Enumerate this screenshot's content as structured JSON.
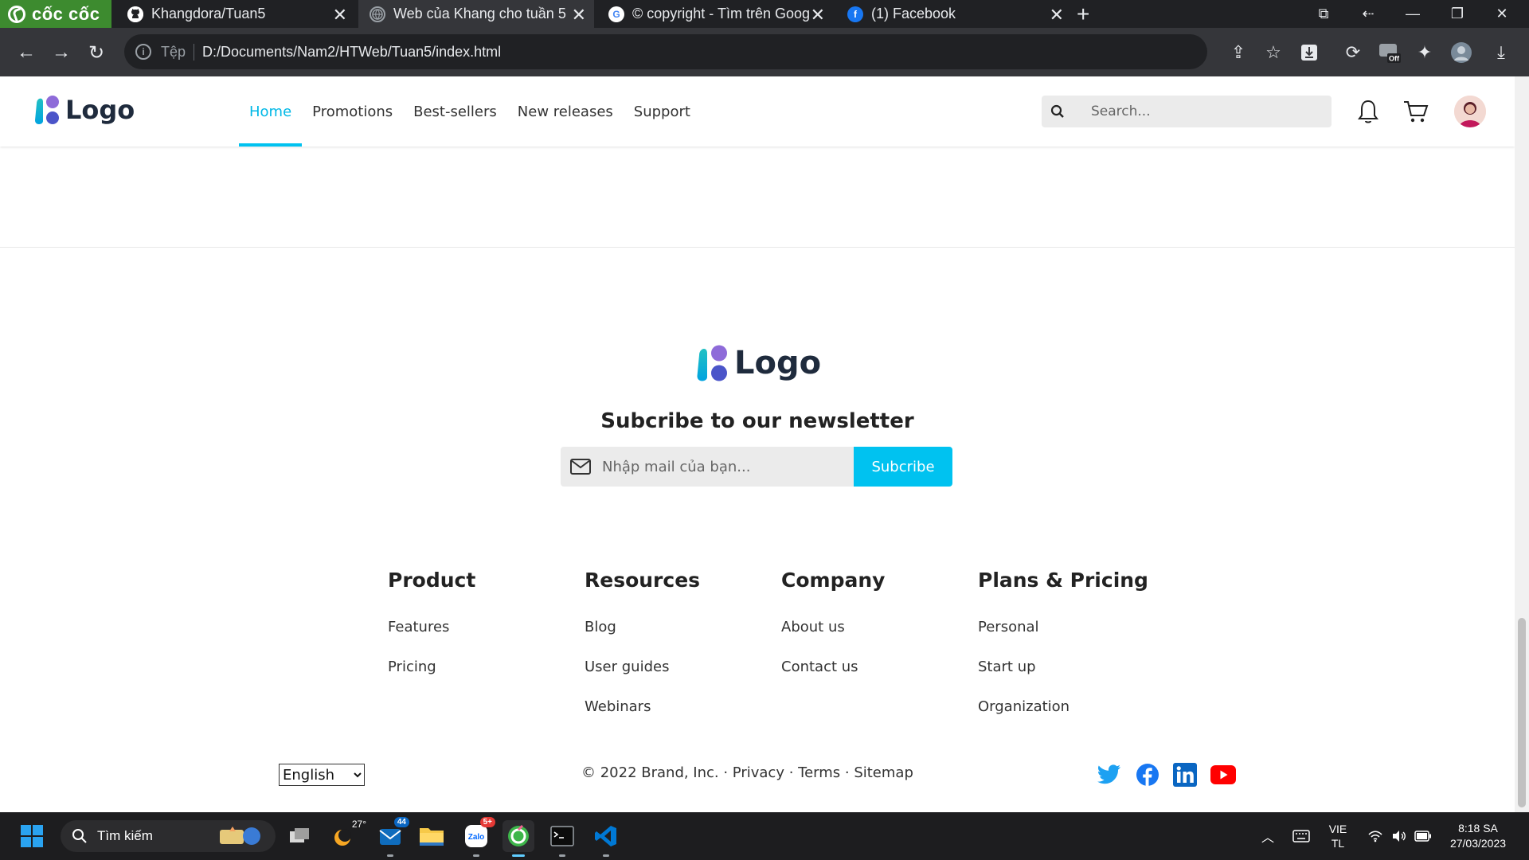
{
  "browser": {
    "brand": "cốc cốc",
    "tabs": [
      {
        "title": "Khangdora/Tuan5",
        "icon": "github-icon"
      },
      {
        "title": "Web của Khang cho tuần 5",
        "icon": "globe-icon"
      },
      {
        "title": "© copyright - Tìm trên Goog",
        "icon": "google-icon"
      },
      {
        "title": "(1) Facebook",
        "icon": "facebook-icon"
      }
    ],
    "address_scheme": "Tệp",
    "address_url": "D:/Documents/Nam2/HTWeb/Tuan5/index.html",
    "extension_badge": "Off"
  },
  "site": {
    "logo_text": "Logo",
    "nav": [
      {
        "label": "Home",
        "active": true
      },
      {
        "label": "Promotions",
        "active": false
      },
      {
        "label": "Best-sellers",
        "active": false
      },
      {
        "label": "New releases",
        "active": false
      },
      {
        "label": "Support",
        "active": false
      }
    ],
    "search_placeholder": "Search...",
    "accent_color": "#00c2f0",
    "newsletter": {
      "title": "Subcribe to our newsletter",
      "placeholder": "Nhập mail của bạn...",
      "button": "Subcribe"
    },
    "footer_columns": [
      {
        "title": "Product",
        "links": [
          "Features",
          "Pricing"
        ]
      },
      {
        "title": "Resources",
        "links": [
          "Blog",
          "User guides",
          "Webinars"
        ]
      },
      {
        "title": "Company",
        "links": [
          "About us",
          "Contact us"
        ]
      },
      {
        "title": "Plans & Pricing",
        "links": [
          "Personal",
          "Start up",
          "Organization"
        ]
      }
    ],
    "language": "English",
    "legal_text": "© 2022 Brand, Inc. · Privacy · Terms · Sitemap",
    "social": [
      "twitter-icon",
      "facebook-icon",
      "linkedin-icon",
      "youtube-icon"
    ]
  },
  "taskbar": {
    "search_label": "Tìm kiếm",
    "weather_temp": "27°",
    "mail_badge": "44",
    "zalo_badge": "5+",
    "lang_top": "VIE",
    "lang_bottom": "TL",
    "time": "8:18 SA",
    "date": "27/03/2023"
  }
}
